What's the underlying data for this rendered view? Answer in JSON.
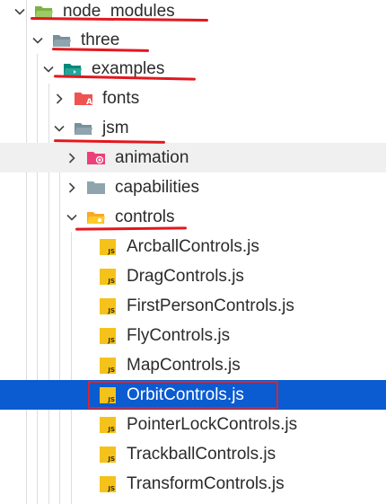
{
  "tree": {
    "folders": {
      "node_modules": "node_modules",
      "three": "three",
      "examples": "examples",
      "fonts": "fonts",
      "jsm": "jsm",
      "animation": "animation",
      "capabilities": "capabilities",
      "controls": "controls"
    },
    "files": [
      "ArcballControls.js",
      "DragControls.js",
      "FirstPersonControls.js",
      "FlyControls.js",
      "MapControls.js",
      "OrbitControls.js",
      "PointerLockControls.js",
      "TrackballControls.js",
      "TransformControls.js"
    ],
    "js_icon_text": "JS",
    "selected_file": "OrbitControls.js"
  },
  "colors": {
    "selection": "#0b5bd1",
    "annotation": "#e3171e",
    "js_icon": "#f5c21b",
    "folder": "#90a4ae",
    "folder_node": "#8bc34a",
    "folder_examples": "#26a69a",
    "folder_fonts": "#ef5350",
    "folder_animation": "#ec407a",
    "folder_controls": "#ffca28"
  }
}
